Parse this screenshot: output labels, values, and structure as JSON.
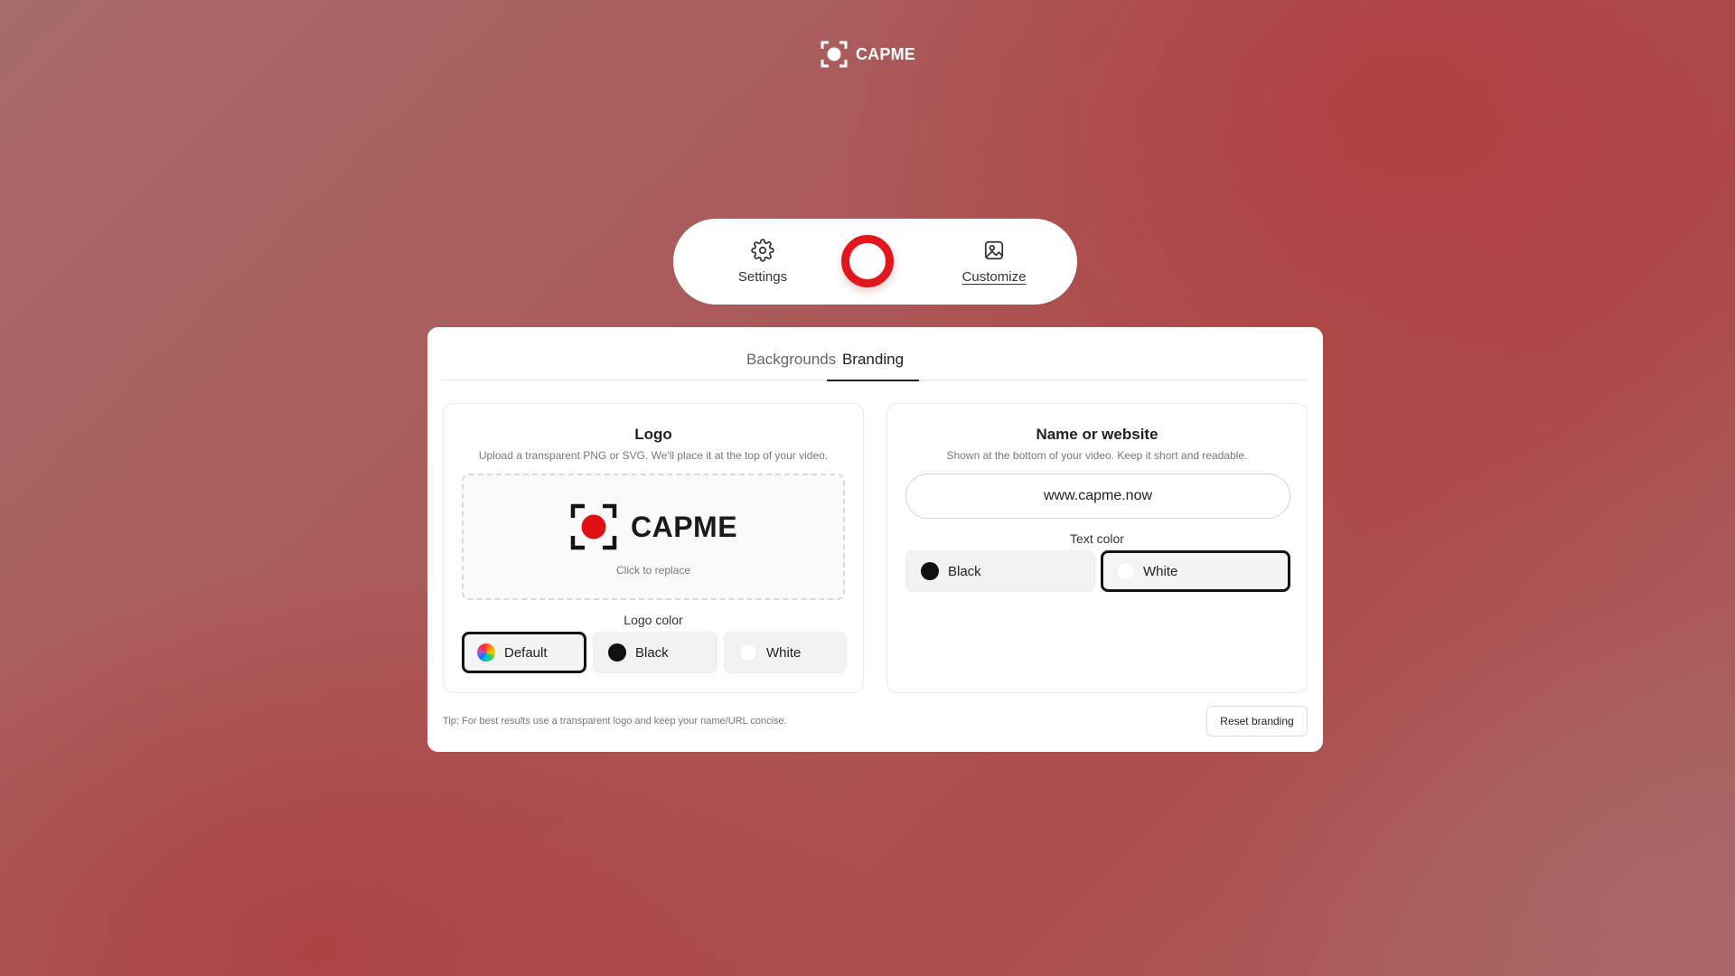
{
  "app": {
    "brand_name": "CAPME"
  },
  "toolbar": {
    "settings_label": "Settings",
    "customize_label": "Customize",
    "record_color": "#e0171d"
  },
  "tabs": [
    {
      "label": "Backgrounds",
      "active": false
    },
    {
      "label": "Branding",
      "active": true
    }
  ],
  "logo_card": {
    "title": "Logo",
    "description": "Upload a transparent PNG or SVG. We'll place it at the top of your video.",
    "preview_wordmark": "CAPME",
    "replace_hint": "Click to replace",
    "color_label": "Logo color",
    "color_options": [
      {
        "label": "Default",
        "icon": "rainbow-dot-icon",
        "selected": true
      },
      {
        "label": "Black",
        "icon": "black-dot-icon",
        "selected": false
      },
      {
        "label": "White",
        "icon": "white-dot-icon",
        "selected": false
      }
    ]
  },
  "name_card": {
    "title": "Name or website",
    "description": "Shown at the bottom of your video. Keep it short and readable.",
    "input_value": "www.capme.now",
    "color_label": "Text color",
    "color_options": [
      {
        "label": "Black",
        "icon": "black-dot-icon",
        "selected": false
      },
      {
        "label": "White",
        "icon": "white-dot-icon",
        "selected": true
      }
    ]
  },
  "footer": {
    "tip": "Tip: For best results use a transparent logo and keep your name/URL concise.",
    "reset_label": "Reset branding"
  }
}
